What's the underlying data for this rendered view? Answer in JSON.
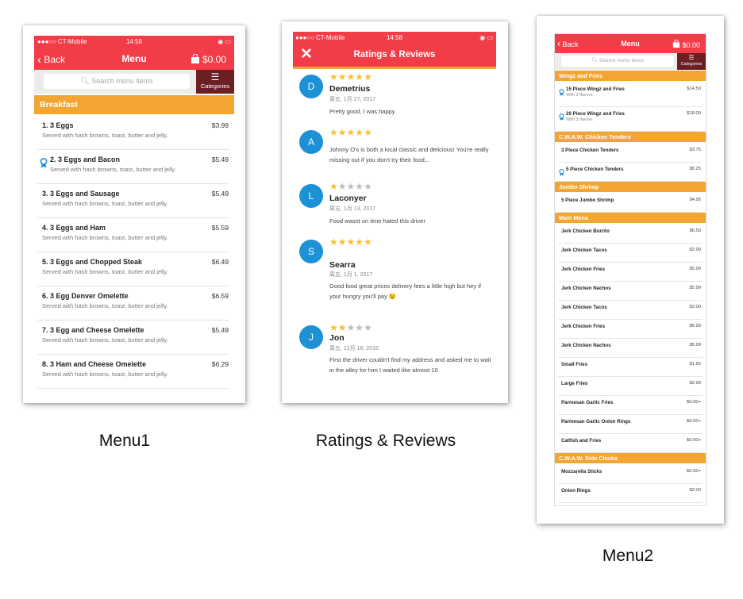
{
  "colors": {
    "accent_red": "#f23c48",
    "section_orange": "#f2a531",
    "categories_bg": "#6b1f23",
    "avatar_blue": "#1d91d6",
    "star_gold": "#f2c233",
    "star_grey": "#bdbdbd"
  },
  "captions": {
    "menu1": "Menu1",
    "reviews": "Ratings & Reviews",
    "menu2": "Menu2"
  },
  "menu1": {
    "status": {
      "carrier": "CT-Mobile",
      "time": "14:58"
    },
    "nav": {
      "back": "Back",
      "title": "Menu",
      "cart_total": "$0.00"
    },
    "search": {
      "placeholder": "Search menu items",
      "categories": "Categories"
    },
    "section": "Breakfast",
    "items": [
      {
        "name": "1. 3 Eggs",
        "desc": "Served with hash browns, toast, butter and jelly.",
        "price": "$3.99",
        "icon": ""
      },
      {
        "name": "2. 3 Eggs and Bacon",
        "desc": "Served with hash browns, toast, butter and jelly.",
        "price": "$5.49",
        "icon": "award-ribbon-icon"
      },
      {
        "name": "3. 3 Eggs and Sausage",
        "desc": "Served with hash browns, toast, butter and jelly.",
        "price": "$5.49",
        "icon": ""
      },
      {
        "name": "4. 3 Eggs and Ham",
        "desc": "Served with hash browns, toast, butter and jelly.",
        "price": "$5.59",
        "icon": ""
      },
      {
        "name": "5. 3 Eggs and Chopped Steak",
        "desc": "Served with hash browns, toast, butter and jelly.",
        "price": "$6.49",
        "icon": ""
      },
      {
        "name": "6. 3 Egg Denver Omelette",
        "desc": "Served with hash browns, toast, butter and jelly.",
        "price": "$6.59",
        "icon": ""
      },
      {
        "name": "7. 3 Egg and Cheese Omelette",
        "desc": "Served with hash browns, toast, butter and jelly.",
        "price": "$5.49",
        "icon": ""
      },
      {
        "name": "8. 3 Ham and Cheese Omelette",
        "desc": "Served with hash browns, toast, butter and jelly.",
        "price": "$6.29",
        "icon": ""
      }
    ]
  },
  "reviews": {
    "status": {
      "carrier": "CT-Mobile",
      "time": "14:58"
    },
    "nav": {
      "title": "Ratings & Reviews"
    },
    "items": [
      {
        "initial": "D",
        "rating": 5,
        "name": "Demetrius",
        "date": "周五, 1月 27, 2017",
        "text": "Pretty good, I was happy"
      },
      {
        "initial": "A",
        "rating": 5,
        "name": "",
        "date": "",
        "text": "Johnny O's is both a local classic and delicious! You're really missing out if you don't try their food..."
      },
      {
        "initial": "L",
        "rating": 1,
        "name": "Laconyer",
        "date": "周五, 1月 13, 2017",
        "text": "Food wasnt on time hated this driver"
      },
      {
        "initial": "S",
        "rating": 5,
        "name": "Searra",
        "date": "周五, 1月 1, 2017",
        "text": "Good food great prices delivery fees a little high but hey if your hungry you'll pay 😉"
      },
      {
        "initial": "J",
        "rating": 2,
        "name": "Jon",
        "date": "周五, 12月 16, 2016",
        "text": "First the driver couldn't find my address and asked me to wait in the alley for him I waited like almost 10"
      }
    ]
  },
  "menu2": {
    "nav": {
      "back": "Back",
      "title": "Menu",
      "cart_total": "$0.00"
    },
    "search": {
      "placeholder": "Search menu items",
      "categories": "Categories"
    },
    "rows": [
      {
        "kind": "section",
        "label": "Wingz and Fries"
      },
      {
        "kind": "item",
        "name": "15 Piece Wingz and Fries",
        "desc": "With 3 flavors.",
        "price": "$14.50",
        "icon": "award-ribbon-icon"
      },
      {
        "kind": "item",
        "name": "20 Piece Wingz and Fries",
        "desc": "With 3 flavors.",
        "price": "$18.00",
        "icon": "award-ribbon-icon"
      },
      {
        "kind": "section",
        "label": "C.W.A.W. Chicken Tenders"
      },
      {
        "kind": "item",
        "name": "3 Piece Chicken Tenders",
        "desc": "",
        "price": "$3.75",
        "icon": ""
      },
      {
        "kind": "item",
        "name": "5 Piece Chicken Tenders",
        "desc": "",
        "price": "$5.25",
        "icon": "award-ribbon-icon"
      },
      {
        "kind": "section",
        "label": "Jumbo Shrimp"
      },
      {
        "kind": "item",
        "name": "5 Piece Jumbo Shrimp",
        "desc": "",
        "price": "$4.95",
        "icon": ""
      },
      {
        "kind": "section",
        "label": "Main Menu"
      },
      {
        "kind": "item",
        "name": "Jerk Chicken Burrito",
        "desc": "",
        "price": "$6.50",
        "icon": ""
      },
      {
        "kind": "item",
        "name": "Jerk Chicken Tacos",
        "desc": "",
        "price": "$2.99",
        "icon": ""
      },
      {
        "kind": "item",
        "name": "Jerk Chicken Fries",
        "desc": "",
        "price": "$5.99",
        "icon": ""
      },
      {
        "kind": "item",
        "name": "Jerk Chicken Nachos",
        "desc": "",
        "price": "$5.99",
        "icon": ""
      },
      {
        "kind": "item",
        "name": "Jerk Chicken Tacos",
        "desc": "",
        "price": "$2.00",
        "icon": ""
      },
      {
        "kind": "item",
        "name": "Jerk Chicken Fries",
        "desc": "",
        "price": "$5.99",
        "icon": ""
      },
      {
        "kind": "item",
        "name": "Jerk Chicken Nachos",
        "desc": "",
        "price": "$5.99",
        "icon": ""
      },
      {
        "kind": "item",
        "name": "Small Fries",
        "desc": "",
        "price": "$1.65",
        "icon": ""
      },
      {
        "kind": "item",
        "name": "Large Fries",
        "desc": "",
        "price": "$2.99",
        "icon": ""
      },
      {
        "kind": "item",
        "name": "Parmesan Garlic Fries",
        "desc": "",
        "price": "$0.00+",
        "icon": ""
      },
      {
        "kind": "item",
        "name": "Parmesan Garlic Onion Rings",
        "desc": "",
        "price": "$0.00+",
        "icon": ""
      },
      {
        "kind": "item",
        "name": "Catfish and Fries",
        "desc": "",
        "price": "$0.00+",
        "icon": ""
      },
      {
        "kind": "section",
        "label": "C.W.A.W. Side Chicks"
      },
      {
        "kind": "item",
        "name": "Mozzarella Sticks",
        "desc": "",
        "price": "$0.00+",
        "icon": ""
      },
      {
        "kind": "item",
        "name": "Onion Rings",
        "desc": "",
        "price": "$2.00",
        "icon": ""
      }
    ]
  }
}
